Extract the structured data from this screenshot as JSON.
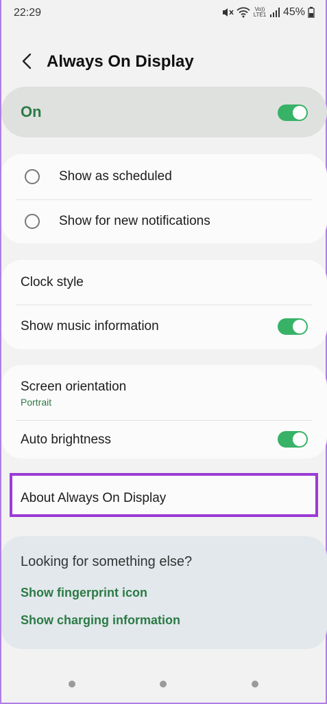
{
  "status_bar": {
    "time": "22:29",
    "volte_label": "Vo))\nLTE1",
    "battery_percent": "45%"
  },
  "header": {
    "title": "Always On Display"
  },
  "master_switch": {
    "label": "On",
    "enabled": true
  },
  "mode_options": [
    {
      "label": "Show as scheduled",
      "selected": false
    },
    {
      "label": "Show for new notifications",
      "selected": false
    }
  ],
  "settings": {
    "clock_style": "Clock style",
    "show_music": {
      "label": "Show music information",
      "enabled": true
    },
    "screen_orientation": {
      "label": "Screen orientation",
      "value": "Portrait"
    },
    "auto_brightness": {
      "label": "Auto brightness",
      "enabled": true
    },
    "about": "About Always On Display"
  },
  "suggestions": {
    "title": "Looking for something else?",
    "links": [
      "Show fingerprint icon",
      "Show charging information"
    ]
  },
  "colors": {
    "accent_green": "#2c7a45",
    "toggle_green": "#38b266",
    "highlight_purple": "#9b3bd6"
  }
}
